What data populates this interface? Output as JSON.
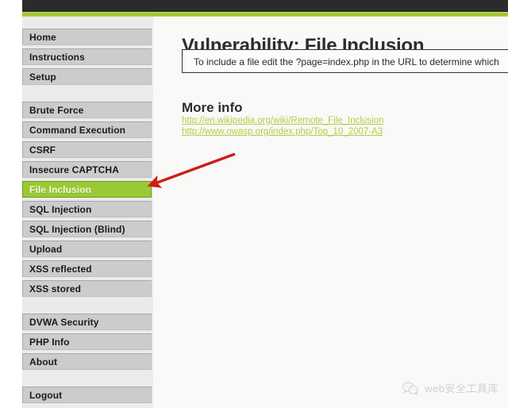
{
  "window": {
    "top_bar_color": "#2b2b2b",
    "accent_stripe_color": "#a3c62e"
  },
  "sidebar": {
    "groups": [
      {
        "items": [
          {
            "label": "Home",
            "active": false
          },
          {
            "label": "Instructions",
            "active": false
          },
          {
            "label": "Setup",
            "active": false
          }
        ]
      },
      {
        "items": [
          {
            "label": "Brute Force",
            "active": false
          },
          {
            "label": "Command Execution",
            "active": false
          },
          {
            "label": "CSRF",
            "active": false
          },
          {
            "label": "Insecure CAPTCHA",
            "active": false
          },
          {
            "label": "File Inclusion",
            "active": true
          },
          {
            "label": "SQL Injection",
            "active": false
          },
          {
            "label": "SQL Injection (Blind)",
            "active": false
          },
          {
            "label": "Upload",
            "active": false
          },
          {
            "label": "XSS reflected",
            "active": false
          },
          {
            "label": "XSS stored",
            "active": false
          }
        ]
      },
      {
        "items": [
          {
            "label": "DVWA Security",
            "active": false
          },
          {
            "label": "PHP Info",
            "active": false
          },
          {
            "label": "About",
            "active": false
          }
        ]
      },
      {
        "items": [
          {
            "label": "Logout",
            "active": false
          }
        ]
      }
    ],
    "active_item_color": "#9ac935",
    "button_color": "#cccccc"
  },
  "main": {
    "title": "Vulnerability: File Inclusion",
    "info_box_text": "To include a file edit the ?page=index.php in the URL to determine which",
    "section_heading": "More info",
    "links": [
      "http://en.wikipedia.org/wiki/Remote_File_Inclusion",
      "http://www.owasp.org/index.php/Top_10_2007-A3"
    ],
    "link_color": "#b9c948"
  },
  "annotation": {
    "arrow_color": "#cc1f16",
    "points_to": "File Inclusion"
  },
  "watermark": {
    "text": "web安全工具库",
    "icon": "wechat-icon"
  }
}
